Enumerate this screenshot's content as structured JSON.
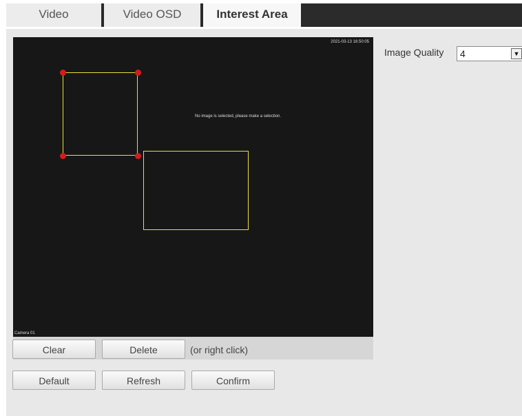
{
  "tabs": [
    {
      "label": "Video"
    },
    {
      "label": "Video OSD"
    },
    {
      "label": "Interest Area"
    }
  ],
  "active_tab": "Interest Area",
  "preview": {
    "timestamp": "2021-03-13 16:50:05",
    "center_text": "No image is selected, please make a selection.",
    "channel_label": "Camera 01"
  },
  "buttons": {
    "clear": "Clear",
    "delete": "Delete",
    "delete_hint": "(or right click)",
    "default": "Default",
    "refresh": "Refresh",
    "confirm": "Confirm"
  },
  "image_quality": {
    "label": "Image Quality",
    "value": "4"
  },
  "colors": {
    "roi_border": "#e8e23a",
    "roi_handle": "#d51b1b",
    "tabbar": "#2b2b2b"
  }
}
